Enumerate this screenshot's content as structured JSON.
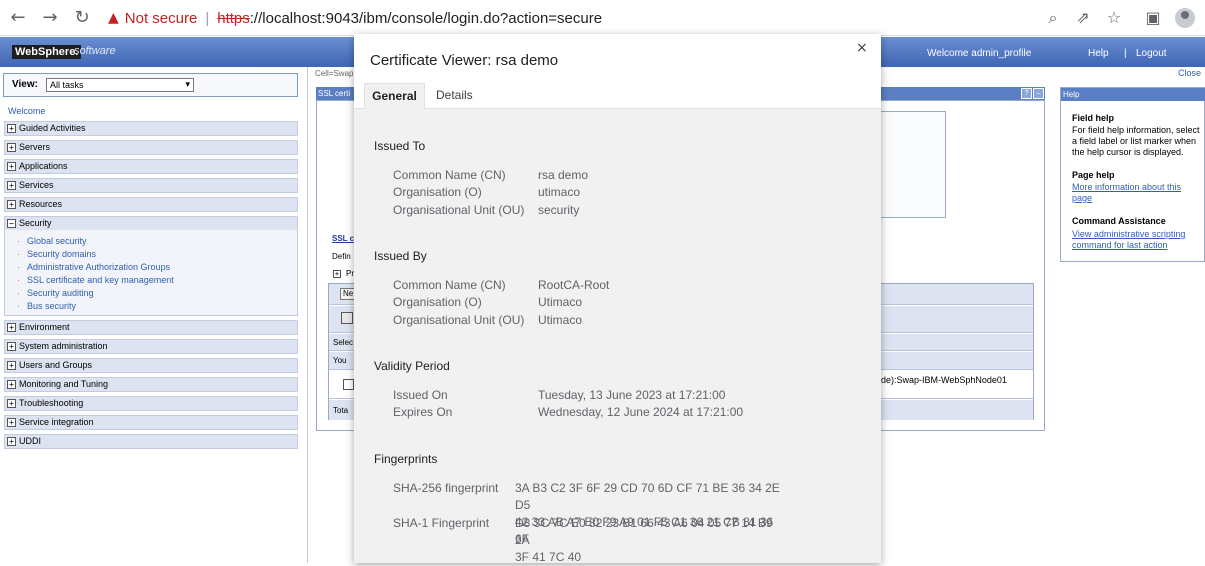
{
  "browser": {
    "back_glyph": "←",
    "forward_glyph": "→",
    "reload_glyph": "↻",
    "warning_glyph": "▲",
    "not_secure": "Not secure",
    "separator": "|",
    "url_scheme": "https",
    "url_rest": "://localhost:9043/ibm/console/login.do?action=secure",
    "icons": [
      "search-icon",
      "share-icon",
      "star-icon",
      "sidebar-icon",
      "profile-icon"
    ],
    "zoom_glyph": "⌕",
    "share_glyph": "⇗",
    "star_glyph": "☆",
    "panel_glyph": "▣"
  },
  "header": {
    "logo_text": "WebSphere.",
    "logo_suffix": "software",
    "welcome": "Welcome admin_profile",
    "help": "Help",
    "divider": "|",
    "logout": "Logout"
  },
  "nav": {
    "view_label": "View:",
    "view_value": "All tasks",
    "view_chevron": "▾",
    "welcome": "Welcome",
    "expand_glyph": "+",
    "collapse_glyph": "−",
    "categories": [
      "Guided Activities",
      "Servers",
      "Applications",
      "Services",
      "Resources",
      "Security"
    ],
    "security_items": [
      "Global security",
      "Security domains",
      "Administrative Authorization Groups",
      "SSL certificate and key management",
      "Security auditing",
      "Bus security"
    ],
    "categories_after": [
      "Environment",
      "System administration",
      "Users and Groups",
      "Monitoring and Tuning",
      "Troubleshooting",
      "Service integration",
      "UDDI"
    ]
  },
  "main": {
    "cell_label": "Cell=Swap",
    "ssl_header": "SSL certi",
    "help_btn": "?",
    "min_btn": "–",
    "ssl_link": "SSL c",
    "def_text": "Defin",
    "pr_text": "Pr",
    "new_btn": "Ne",
    "select_text": "Selec",
    "you_text": "You",
    "total_text": "Tota",
    "row_node": "de):Swap-IBM-WebSphNode01"
  },
  "help_panel": {
    "close": "Close",
    "title": "Help",
    "field_help_h": "Field help",
    "field_help_t": "For field help information, select\na field label or list marker when\nthe help cursor is displayed.",
    "page_help_h": "Page help",
    "page_help_l": "More information about this\npage",
    "cmd_h": "Command Assistance",
    "cmd_l": "View administrative scripting\ncommand for last action"
  },
  "dialog": {
    "title": "Certificate Viewer: rsa demo",
    "close_glyph": "×",
    "tabs": [
      "General",
      "Details"
    ],
    "issued_to": {
      "heading": "Issued To",
      "rows": [
        {
          "k": "Common Name (CN)",
          "v": "rsa demo"
        },
        {
          "k": "Organisation (O)",
          "v": "utimaco"
        },
        {
          "k": "Organisational Unit (OU)",
          "v": "security"
        }
      ]
    },
    "issued_by": {
      "heading": "Issued By",
      "rows": [
        {
          "k": "Common Name (CN)",
          "v": "RootCA-Root"
        },
        {
          "k": "Organisation (O)",
          "v": "Utimaco"
        },
        {
          "k": "Organisational Unit (OU)",
          "v": "Utimaco"
        }
      ]
    },
    "validity": {
      "heading": "Validity Period",
      "rows": [
        {
          "k": "Issued On",
          "v": "Tuesday, 13 June 2023 at 17:21:00"
        },
        {
          "k": "Expires On",
          "v": "Wednesday, 12 June 2024 at 17:21:00"
        }
      ]
    },
    "fingerprints": {
      "heading": "Fingerprints",
      "sha256_label": "SHA-256 fingerprint",
      "sha256_value": "3A B3 C2 3F 6F 29 CD 70 6D CF 71 BE 36 34 2E D5\n42 33 AB A7 E0 F9 A9 01 F5 C1 36 21 CB 81 36 6F",
      "sha1_label": "SHA-1 Fingerprint",
      "sha1_value": "D8 3C 7C E0 82 23 B1 66 43 A6 04 05 77 14 B9 2A\n3F 41 7C 40"
    }
  }
}
